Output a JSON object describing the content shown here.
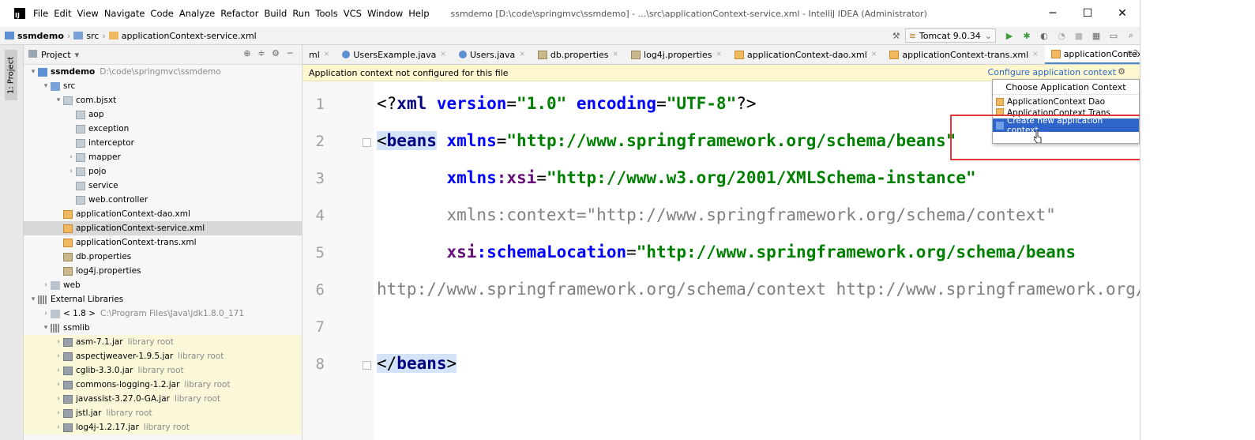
{
  "menu": {
    "items": [
      "File",
      "Edit",
      "View",
      "Navigate",
      "Code",
      "Analyze",
      "Refactor",
      "Build",
      "Run",
      "Tools",
      "VCS",
      "Window",
      "Help"
    ],
    "window_title": "ssmdemo [D:\\code\\springmvc\\ssmdemo] - ...\\src\\applicationContext-service.xml - IntelliJ IDEA (Administrator)",
    "minimize": "─",
    "maximize": "☐",
    "close": "✕"
  },
  "navbar": {
    "crumbs": [
      "ssmdemo",
      "src",
      "applicationContext-service.xml"
    ],
    "run_config": "Tomcat 9.0.34"
  },
  "left_stripe": {
    "label": "1: Project"
  },
  "project": {
    "title": "Project",
    "tree": [
      {
        "label": "ssmdemo",
        "extra": "D:\\code\\springmvc\\ssmdemo",
        "depth": 0,
        "arrow": "▾",
        "icon": "module",
        "bold": true
      },
      {
        "label": "src",
        "extra": "",
        "depth": 1,
        "arrow": "▾",
        "icon": "srcfolder"
      },
      {
        "label": "com.bjsxt",
        "extra": "",
        "depth": 2,
        "arrow": "▾",
        "icon": "pkg"
      },
      {
        "label": "aop",
        "extra": "",
        "depth": 3,
        "arrow": "",
        "icon": "pkg"
      },
      {
        "label": "exception",
        "extra": "",
        "depth": 3,
        "arrow": "",
        "icon": "pkg"
      },
      {
        "label": "interceptor",
        "extra": "",
        "depth": 3,
        "arrow": "",
        "icon": "pkg"
      },
      {
        "label": "mapper",
        "extra": "",
        "depth": 3,
        "arrow": "›",
        "icon": "pkg"
      },
      {
        "label": "pojo",
        "extra": "",
        "depth": 3,
        "arrow": "›",
        "icon": "pkg"
      },
      {
        "label": "service",
        "extra": "",
        "depth": 3,
        "arrow": "",
        "icon": "pkg"
      },
      {
        "label": "web.controller",
        "extra": "",
        "depth": 3,
        "arrow": "",
        "icon": "pkg"
      },
      {
        "label": "applicationContext-dao.xml",
        "extra": "",
        "depth": 2,
        "arrow": "",
        "icon": "xml"
      },
      {
        "label": "applicationContext-service.xml",
        "extra": "",
        "depth": 2,
        "arrow": "",
        "icon": "xml",
        "selected": true
      },
      {
        "label": "applicationContext-trans.xml",
        "extra": "",
        "depth": 2,
        "arrow": "",
        "icon": "xml"
      },
      {
        "label": "db.properties",
        "extra": "",
        "depth": 2,
        "arrow": "",
        "icon": "props"
      },
      {
        "label": "log4j.properties",
        "extra": "",
        "depth": 2,
        "arrow": "",
        "icon": "props"
      },
      {
        "label": "web",
        "extra": "",
        "depth": 1,
        "arrow": "›",
        "icon": "folder"
      },
      {
        "label": "External Libraries",
        "extra": "",
        "depth": 0,
        "arrow": "▾",
        "icon": "lib"
      },
      {
        "label": "< 1.8 >",
        "extra": "C:\\Program Files\\Java\\jdk1.8.0_171",
        "depth": 1,
        "arrow": "›",
        "icon": "folder"
      },
      {
        "label": "ssmlib",
        "extra": "",
        "depth": 1,
        "arrow": "▾",
        "icon": "lib"
      },
      {
        "label": "asm-7.1.jar",
        "extra": "library root",
        "depth": 2,
        "arrow": "›",
        "icon": "jar",
        "lib": true
      },
      {
        "label": "aspectjweaver-1.9.5.jar",
        "extra": "library root",
        "depth": 2,
        "arrow": "›",
        "icon": "jar",
        "lib": true
      },
      {
        "label": "cglib-3.3.0.jar",
        "extra": "library root",
        "depth": 2,
        "arrow": "›",
        "icon": "jar",
        "lib": true
      },
      {
        "label": "commons-logging-1.2.jar",
        "extra": "library root",
        "depth": 2,
        "arrow": "›",
        "icon": "jar",
        "lib": true
      },
      {
        "label": "javassist-3.27.0-GA.jar",
        "extra": "library root",
        "depth": 2,
        "arrow": "›",
        "icon": "jar",
        "lib": true
      },
      {
        "label": "jstl.jar",
        "extra": "library root",
        "depth": 2,
        "arrow": "›",
        "icon": "jar",
        "lib": true
      },
      {
        "label": "log4j-1.2.17.jar",
        "extra": "library root",
        "depth": 2,
        "arrow": "›",
        "icon": "jar",
        "lib": true
      }
    ]
  },
  "tabs": [
    {
      "label": "ml",
      "icon": "none",
      "close": "×"
    },
    {
      "label": "UsersExample.java",
      "icon": "java",
      "close": "×"
    },
    {
      "label": "Users.java",
      "icon": "java",
      "close": "×"
    },
    {
      "label": "db.properties",
      "icon": "props",
      "close": "×"
    },
    {
      "label": "log4j.properties",
      "icon": "props",
      "close": "×"
    },
    {
      "label": "applicationContext-dao.xml",
      "icon": "xml",
      "close": "×"
    },
    {
      "label": "applicationContext-trans.xml",
      "icon": "xml",
      "close": "×"
    },
    {
      "label": "applicationContext-service.xm",
      "icon": "xml",
      "close": "",
      "active": true
    }
  ],
  "tabs_more": "≡2",
  "banner": {
    "message": "Application context not configured for this file",
    "action": "Configure application context"
  },
  "popup": {
    "title": "Choose Application Context",
    "items": [
      "ApplicationContext Dao",
      "ApplicationContext Trans",
      "Create new application context..."
    ]
  },
  "editor": {
    "line_numbers": [
      "1",
      "2",
      "3",
      "4",
      "5",
      "6",
      "7",
      "8"
    ]
  }
}
